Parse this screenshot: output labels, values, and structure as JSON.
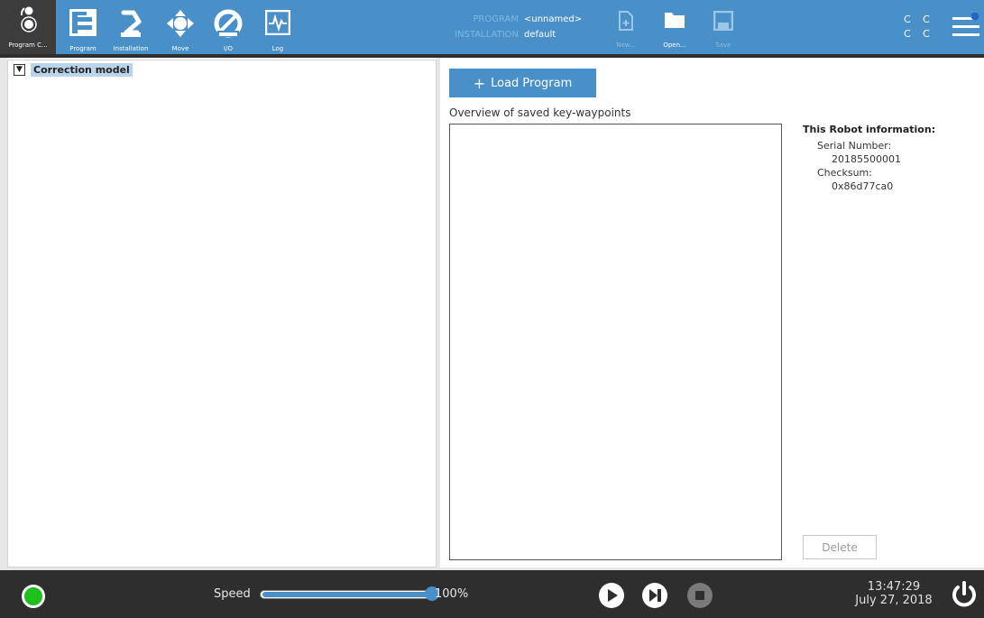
{
  "topbar": {
    "tabs": [
      {
        "label": "Program C...",
        "icon": "urcap-icon"
      },
      {
        "label": "Program",
        "icon": "program-tree-icon"
      },
      {
        "label": "Installation",
        "icon": "robot-arm-icon"
      },
      {
        "label": "Move",
        "icon": "move-arrows-icon"
      },
      {
        "label": "I/O",
        "icon": "io-gauge-icon"
      },
      {
        "label": "Log",
        "icon": "log-waveform-icon"
      }
    ],
    "program_key": "PROGRAM",
    "program_value": "<unnamed>",
    "installation_key": "INSTALLATION",
    "installation_value": "default",
    "file_buttons": [
      {
        "label": "New...",
        "icon": "new-file-icon",
        "enabled": false
      },
      {
        "label": "Open...",
        "icon": "folder-icon",
        "enabled": true
      },
      {
        "label": "Save",
        "icon": "save-disk-icon",
        "enabled": false
      }
    ],
    "cc_row1": "C C",
    "cc_row2": "C C",
    "menu_icon": "hamburger-menu-icon",
    "colors": {
      "bar": "#4a90c8",
      "notification_dot": "#1e66c8"
    }
  },
  "tree": {
    "root_toggle": "▼",
    "root_label": "Correction model"
  },
  "right": {
    "load_button_icon": "+",
    "load_button_label": "Load Program",
    "overview_label": "Overview of saved key-waypoints",
    "info_title": "This Robot information:",
    "serial_label": "Serial Number:",
    "serial_value": "20185500001",
    "checksum_label": "Checksum:",
    "checksum_value": "0x86d77ca0",
    "delete_label": "Delete"
  },
  "bottombar": {
    "status_color": "#1ec01e",
    "speed_label": "Speed",
    "speed_percent": 100,
    "speed_value": "100%",
    "play_icon": "play-icon",
    "step_icon": "step-icon",
    "stop_icon": "stop-icon",
    "time": "13:47:29",
    "date": "July 27, 2018",
    "power_icon": "power-icon"
  }
}
